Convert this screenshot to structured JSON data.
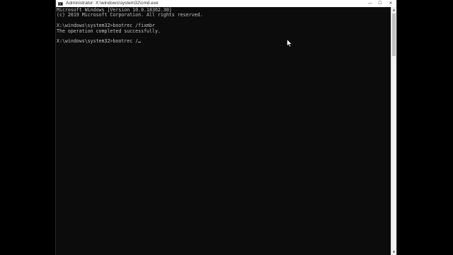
{
  "window": {
    "title": "Administrator: X:\\windows\\system32\\cmd.exe",
    "minimize_label": "—",
    "maximize_label": "☐",
    "close_label": "✕"
  },
  "console": {
    "lines": [
      "Microsoft Windows [Version 10.0.18362.30]",
      "(c) 2019 Microsoft Corporation. All rights reserved.",
      "",
      "X:\\windows\\system32>bootrec /fixmbr",
      "The operation completed successfully.",
      "",
      "X:\\windows\\system32>bootrec /"
    ]
  },
  "scrollbar": {
    "up_arrow": "▲",
    "down_arrow": "▼"
  },
  "icons": {
    "window_icon": "cmd-icon",
    "pointer": "mouse-pointer-icon"
  },
  "colors": {
    "console_background": "#0c0c0c",
    "console_text": "#c0c0c0",
    "titlebar": "#ffffff"
  }
}
